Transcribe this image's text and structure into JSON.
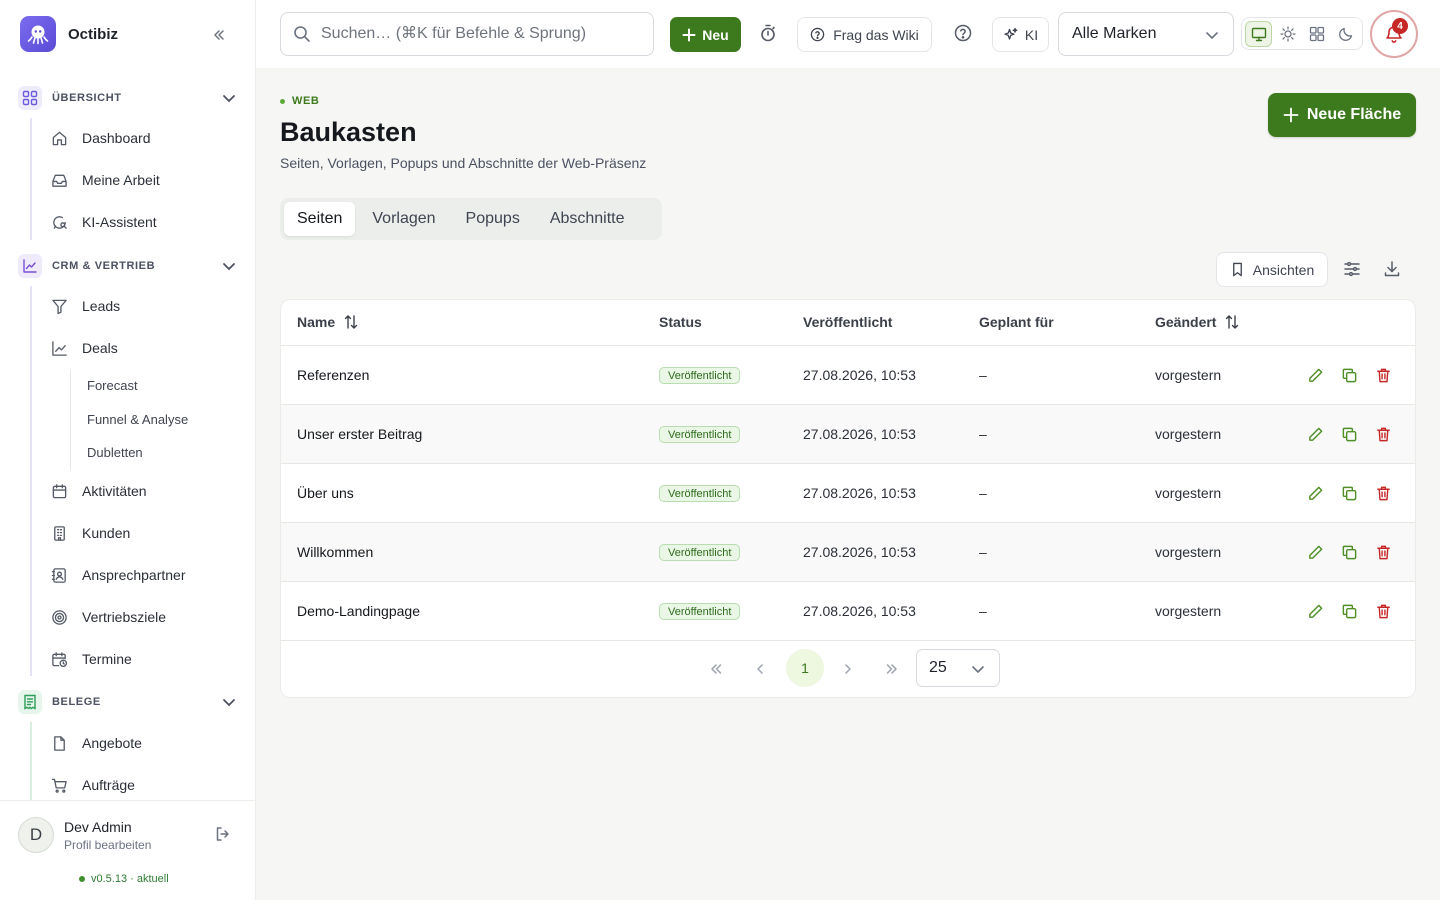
{
  "app": {
    "name": "Octibiz"
  },
  "sidebar": {
    "groups": [
      {
        "label": "ÜBERSICHT",
        "items": [
          "Dashboard",
          "Meine Arbeit",
          "KI-Assistent"
        ]
      },
      {
        "label": "CRM & VERTRIEB",
        "items": [
          "Leads",
          "Deals",
          "Aktivitäten",
          "Kunden",
          "Ansprechpartner",
          "Vertriebsziele",
          "Termine"
        ],
        "deal_subitems": [
          "Forecast",
          "Funnel & Analyse",
          "Dubletten"
        ]
      },
      {
        "label": "BELEGE",
        "items": [
          "Angebote",
          "Aufträge"
        ]
      }
    ],
    "icons": {
      "overview": "grid-icon",
      "crm": "chart-line-icon",
      "belege": "receipt-icon",
      "dashboard": "home-icon",
      "meine_arbeit": "inbox-icon",
      "ki": "chat-search-icon",
      "leads": "filter-icon",
      "deals": "chart-icon",
      "aktivitaeten": "calendar-icon",
      "kunden": "building-icon",
      "ansprechpartner": "contact-icon",
      "vertriebsziele": "target-icon",
      "termine": "calendar-clock-icon",
      "angebote": "file-icon",
      "auftraege": "cart-icon"
    }
  },
  "user": {
    "initial": "D",
    "name": "Dev Admin",
    "subtitle": "Profil bearbeiten"
  },
  "version": {
    "label": "v0.5.13 · aktuell"
  },
  "topbar": {
    "search_placeholder": "Suchen… (⌘K für Befehle & Sprung)",
    "new_label": "Neu",
    "wiki_label": "Frag das Wiki",
    "ki_label": "KI",
    "brand_select": "Alle Marken",
    "notifications_count": "4"
  },
  "page": {
    "eyebrow": "WEB",
    "title": "Baukasten",
    "subtitle": "Seiten, Vorlagen, Popups und Abschnitte der Web-Präsenz",
    "primary_action": "Neue Fläche",
    "tabs": [
      "Seiten",
      "Vorlagen",
      "Popups",
      "Abschnitte"
    ],
    "active_tab": "Seiten",
    "views_label": "Ansichten"
  },
  "table": {
    "columns": [
      "Name",
      "Status",
      "Veröffentlicht",
      "Geplant für",
      "Geändert"
    ],
    "rows": [
      {
        "name": "Referenzen",
        "status": "Veröffentlicht",
        "published": "27.08.2026, 10:53",
        "scheduled": "–",
        "changed": "vorgestern"
      },
      {
        "name": "Unser erster Beitrag",
        "status": "Veröffentlicht",
        "published": "27.08.2026, 10:53",
        "scheduled": "–",
        "changed": "vorgestern"
      },
      {
        "name": "Über uns",
        "status": "Veröffentlicht",
        "published": "27.08.2026, 10:53",
        "scheduled": "–",
        "changed": "vorgestern"
      },
      {
        "name": "Willkommen",
        "status": "Veröffentlicht",
        "published": "27.08.2026, 10:53",
        "scheduled": "–",
        "changed": "vorgestern"
      },
      {
        "name": "Demo-Landingpage",
        "status": "Veröffentlicht",
        "published": "27.08.2026, 10:53",
        "scheduled": "–",
        "changed": "vorgestern"
      }
    ]
  },
  "pagination": {
    "current_page": "1",
    "page_size": "25"
  },
  "colors": {
    "accent": "#3c7a1d",
    "danger": "#c62828",
    "brand": "#6a5ae0"
  }
}
